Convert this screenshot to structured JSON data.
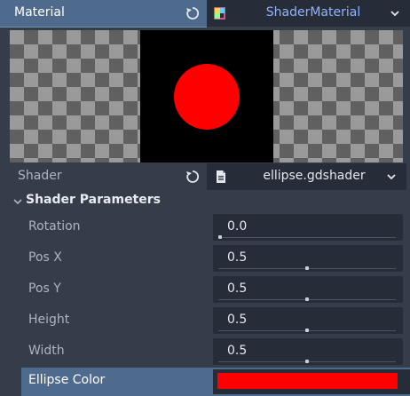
{
  "material": {
    "label": "Material",
    "value": "ShaderMaterial",
    "reset_icon": "reload-icon",
    "resource_icon": "shader-material-icon",
    "chevron_icon": "chevron-down-icon"
  },
  "preview": {
    "ellipse_color": "#ff0000",
    "background": "#000000"
  },
  "shader": {
    "label": "Shader",
    "value": "ellipse.gdshader",
    "file_icon": "file-icon"
  },
  "section": {
    "title": "Shader Parameters",
    "collapsed": false
  },
  "params": [
    {
      "label": "Rotation",
      "value": "0.0",
      "fraction": 0.0
    },
    {
      "label": "Pos X",
      "value": "0.5",
      "fraction": 0.5
    },
    {
      "label": "Pos Y",
      "value": "0.5",
      "fraction": 0.5
    },
    {
      "label": "Height",
      "value": "0.5",
      "fraction": 0.5
    },
    {
      "label": "Width",
      "value": "0.5",
      "fraction": 0.5
    }
  ],
  "ellipse_color": {
    "label": "Ellipse Color",
    "color": "#ff0000"
  }
}
